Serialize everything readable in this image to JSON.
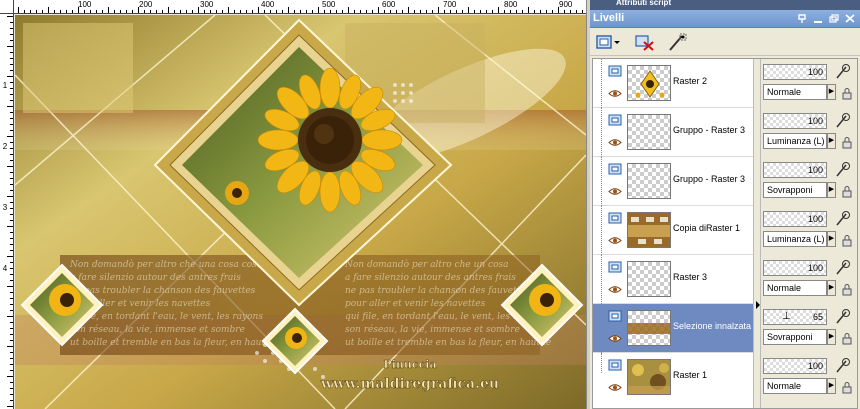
{
  "rulers": {
    "top": [
      "100",
      "200",
      "300",
      "400",
      "500",
      "600",
      "700",
      "800",
      "900"
    ],
    "left": [
      "1",
      "2",
      "3",
      "4"
    ]
  },
  "canvas": {
    "watermark_author": "Pinuccia",
    "watermark_site": "www.maldiregrafica.eu"
  },
  "panel": {
    "prev_title": "Attributi script",
    "title": "Livelli",
    "pin_icon": "pin-icon",
    "minimize_icon": "minimize-icon",
    "restore_icon": "restore-icon",
    "close_icon": "close-icon"
  },
  "toolbar": {
    "new_layer_icon": "new-layer-icon",
    "delete_layer_icon": "delete-layer-icon",
    "edit_icon": "wand-icon"
  },
  "layers": [
    {
      "name": "Raster 2",
      "opacity": "100",
      "blend": "Normale",
      "selected": false
    },
    {
      "name": "Gruppo - Raster 3",
      "opacity": "100",
      "blend": "Luminanza (L)",
      "selected": false
    },
    {
      "name": "Gruppo - Raster 3",
      "opacity": "100",
      "blend": "Sovrapponi",
      "selected": false
    },
    {
      "name": "Copia diRaster 1",
      "opacity": "100",
      "blend": "Luminanza (L)",
      "selected": false
    },
    {
      "name": "Raster 3",
      "opacity": "100",
      "blend": "Normale",
      "selected": false
    },
    {
      "name": "Selezione innalzata",
      "opacity": "65",
      "blend": "Sovrapponi",
      "selected": true
    },
    {
      "name": "Raster 1",
      "opacity": "100",
      "blend": "Normale",
      "selected": false
    }
  ],
  "colors": {
    "panel_title": "#7a9fd6",
    "selected_row": "#6f8ac0"
  }
}
